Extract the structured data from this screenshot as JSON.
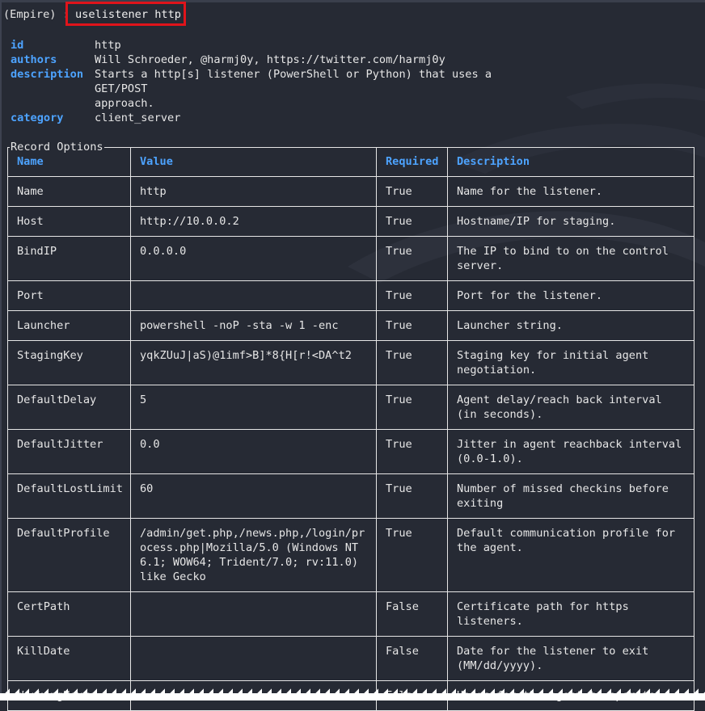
{
  "prompt": "(Empire) :",
  "command": "uselistener http",
  "info": [
    {
      "key": "id",
      "value": "http"
    },
    {
      "key": "authors",
      "value": "Will Schroeder, @harmj0y, https://twitter.com/harmj0y"
    },
    {
      "key": "description",
      "value": "Starts a http[s] listener (PowerShell or Python) that uses a GET/POST\napproach."
    },
    {
      "key": "category",
      "value": "client_server"
    }
  ],
  "section_title": "Record Options",
  "headers": {
    "name": "Name",
    "value": "Value",
    "required": "Required",
    "description": "Description"
  },
  "rows": [
    {
      "name": "Name",
      "value": "http",
      "required": "True",
      "description": "Name for the listener."
    },
    {
      "name": "Host",
      "value": "http://10.0.0.2",
      "required": "True",
      "description": "Hostname/IP for staging."
    },
    {
      "name": "BindIP",
      "value": "0.0.0.0",
      "required": "True",
      "description": "The IP to bind to on the control server."
    },
    {
      "name": "Port",
      "value": "",
      "required": "True",
      "description": "Port for the listener."
    },
    {
      "name": "Launcher",
      "value": "powershell -noP -sta -w 1 -enc",
      "required": "True",
      "description": "Launcher string."
    },
    {
      "name": "StagingKey",
      "value": "yqkZUuJ|aS)@1imf>B]*8{H[r!<DA^t2",
      "required": "True",
      "description": "Staging key for initial agent negotiation."
    },
    {
      "name": "DefaultDelay",
      "value": "5",
      "required": "True",
      "description": "Agent delay/reach back interval (in seconds)."
    },
    {
      "name": "DefaultJitter",
      "value": "0.0",
      "required": "True",
      "description": "Jitter in agent reachback interval (0.0-1.0)."
    },
    {
      "name": "DefaultLostLimit",
      "value": "60",
      "required": "True",
      "description": "Number of missed checkins before exiting"
    },
    {
      "name": "DefaultProfile",
      "value": "/admin/get.php,/news.php,/login/process.php|Mozilla/5.0 (Windows NT 6.1; WOW64; Trident/7.0; rv:11.0) like Gecko",
      "required": "True",
      "description": "Default communication profile for the agent."
    },
    {
      "name": "CertPath",
      "value": "",
      "required": "False",
      "description": "Certificate path for https listeners."
    },
    {
      "name": "KillDate",
      "value": "",
      "required": "False",
      "description": "Date for the listener to exit (MM/dd/yyyy)."
    },
    {
      "name": "WorkingHours",
      "value": "",
      "required": "False",
      "description": "Hours for the agent to operate"
    }
  ],
  "colors": {
    "background": "#262a34",
    "accent": "#4da3ff",
    "highlight": "#e0141b",
    "text": "#e6e6e6"
  }
}
